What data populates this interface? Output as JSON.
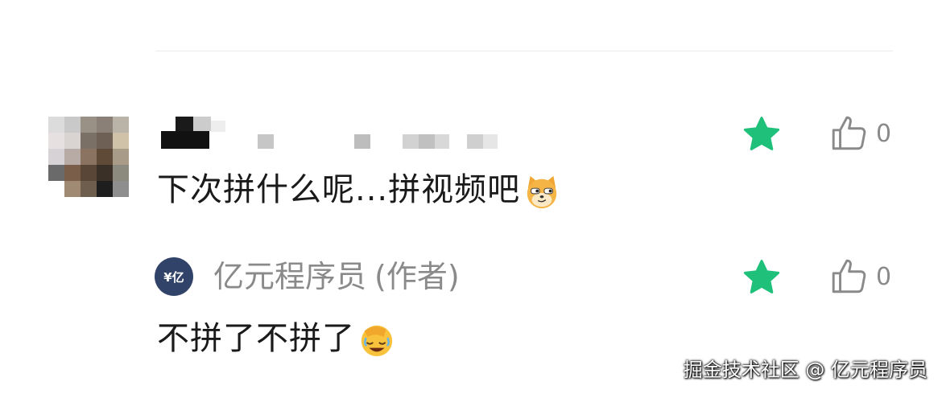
{
  "comments": [
    {
      "text": "下次拼什么呢...拼视频吧",
      "emoji": "cat-smirk-icon",
      "likes": "0",
      "starred": true
    }
  ],
  "reply": {
    "avatar_text": "¥亿",
    "author_name": "亿元程序员",
    "author_tag": "(作者)",
    "text": "不拼了不拼了",
    "emoji": "facepalm-laugh-icon",
    "likes": "0",
    "starred": true
  },
  "watermark": "掘金技术社区 @ 亿元程序员",
  "colors": {
    "star": "#1fc07a",
    "like_icon": "#8a8a8a",
    "author_avatar_bg": "#32436a",
    "divider": "#ececec"
  }
}
